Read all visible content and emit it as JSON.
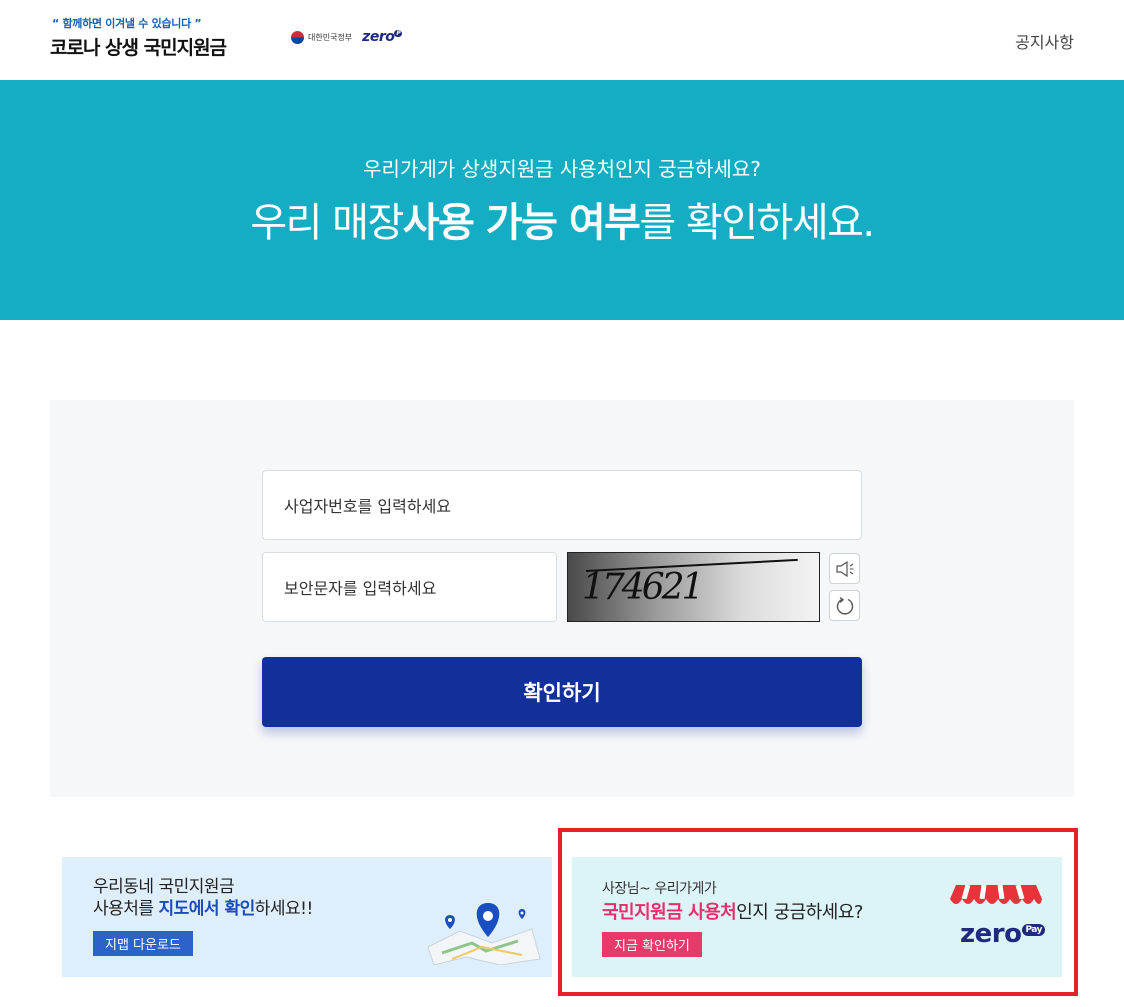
{
  "header": {
    "slogan": "“ 함께하면 이겨낼 수 있습니다 ”",
    "title": "코로나 상생 국민지원금",
    "gov_label": "대한민국정부",
    "zero_label": "zero",
    "notice_link": "공지사항"
  },
  "hero": {
    "subtitle": "우리가게가 상생지원금 사용처인지 궁금하세요?",
    "title_pre": "우리 매장",
    "title_bold": "사용 가능 여부",
    "title_post": "를 확인하세요."
  },
  "form": {
    "biz_placeholder": "사업자번호를 입력하세요",
    "captcha_placeholder": "보안문자를 입력하세요",
    "captcha_code": "174621",
    "confirm_label": "확인하기"
  },
  "banners": {
    "map": {
      "line1": "우리동네 국민지원금",
      "line2_pre": "사용처를 ",
      "line2_em": "지도에서 확인",
      "line2_post": "하세요!!",
      "button": "지맵 다운로드"
    },
    "zero": {
      "line1": "사장님~ 우리가게가",
      "line2_em": "국민지원금 사용처",
      "line2_post": "인지 궁금하세요?",
      "button": "지금 확인하기",
      "logo": "zero",
      "logo_pay": "Pay"
    }
  },
  "colors": {
    "hero_bg": "#14adc3",
    "confirm_bg": "#11309a",
    "highlight_border": "#e5202b"
  }
}
